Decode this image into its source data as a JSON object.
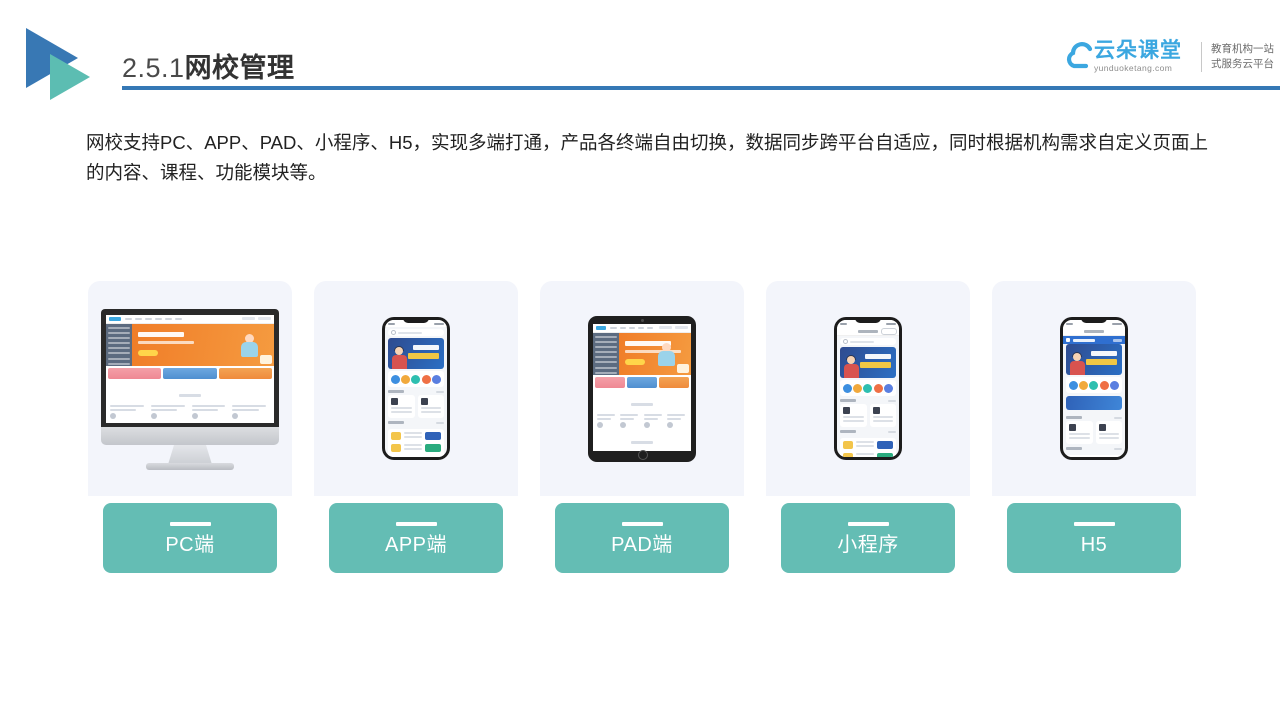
{
  "header": {
    "title_number": "2.5.1",
    "title_name": "网校管理",
    "logo_icon": "double-triangle-logo",
    "accent_blue": "#3578b5",
    "accent_teal": "#5cbdb2"
  },
  "brand": {
    "icon": "cloud-icon",
    "name": "云朵课堂",
    "domain": "yunduoketang.com",
    "tagline_line1": "教育机构一站",
    "tagline_line2": "式服务云平台",
    "color": "#3ba7e0"
  },
  "intro": {
    "paragraph": "网校支持PC、APP、PAD、小程序、H5，实现多端打通，产品各终端自由切换，数据同步跨平台自适应，同时根据机构需求自定义页面上的内容、课程、功能模块等。"
  },
  "cards": [
    {
      "label": "PC端",
      "device": "desktop-monitor"
    },
    {
      "label": "APP端",
      "device": "smartphone"
    },
    {
      "label": "PAD端",
      "device": "tablet"
    },
    {
      "label": "小程序",
      "device": "smartphone-miniprogram"
    },
    {
      "label": "H5",
      "device": "smartphone-browser"
    }
  ],
  "colors": {
    "label_box": "#64bdb4",
    "card_panel": "#f3f5fb",
    "title_text": "#333333"
  }
}
